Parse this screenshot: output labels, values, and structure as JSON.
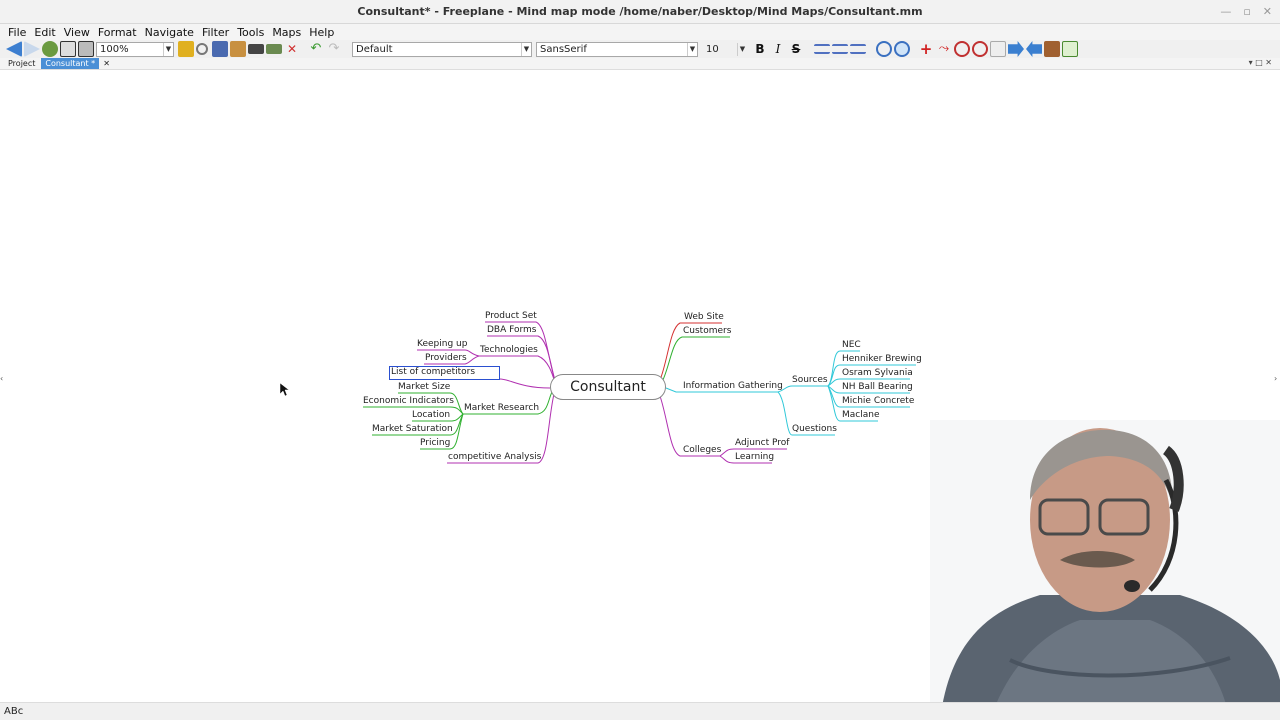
{
  "window": {
    "title": "Consultant* - Freeplane - Mind map mode /home/naber/Desktop/Mind Maps/Consultant.mm"
  },
  "menu": [
    "File",
    "Edit",
    "View",
    "Format",
    "Navigate",
    "Filter",
    "Tools",
    "Maps",
    "Help"
  ],
  "toolbar": {
    "zoom": "100%",
    "style": "Default",
    "font": "SansSerif",
    "size": "10",
    "bold": "B",
    "italic": "I",
    "strike": "S"
  },
  "tabs": {
    "project": "Project",
    "active": "Consultant *"
  },
  "status": {
    "abc": "ABc"
  },
  "mindmap": {
    "root": "Consultant",
    "left": {
      "product_set": "Product Set",
      "dba_forms": "DBA Forms",
      "technologies": "Technologies",
      "keeping_up": "Keeping up",
      "providers": "Providers",
      "list_of_competitors": "List of competitors",
      "market_size": "Market Size",
      "economic_indicators": "Economic Indicators",
      "location": "Location",
      "market_saturation": "Market Saturation",
      "pricing": "Pricing",
      "market_research": "Market Research",
      "competitive_analysis": "competitive Analysis"
    },
    "right": {
      "web_site": "Web Site",
      "customers": "Customers",
      "information_gathering": "Information Gathering",
      "sources": "Sources",
      "nec": "NEC",
      "henniker": "Henniker Brewing",
      "osram": "Osram Sylvania",
      "nh_ball": "NH Ball Bearing",
      "michie": "Michie Concrete",
      "maclane": "Maclane",
      "questions": "Questions",
      "colleges": "Colleges",
      "adjunct_prof": "Adjunct Prof",
      "learning": "Learning"
    }
  },
  "colors": {
    "accent": "#4a8fd6",
    "red": "#d43030",
    "magenta": "#b030b0",
    "green": "#30b030",
    "cyan": "#30c8d8"
  }
}
